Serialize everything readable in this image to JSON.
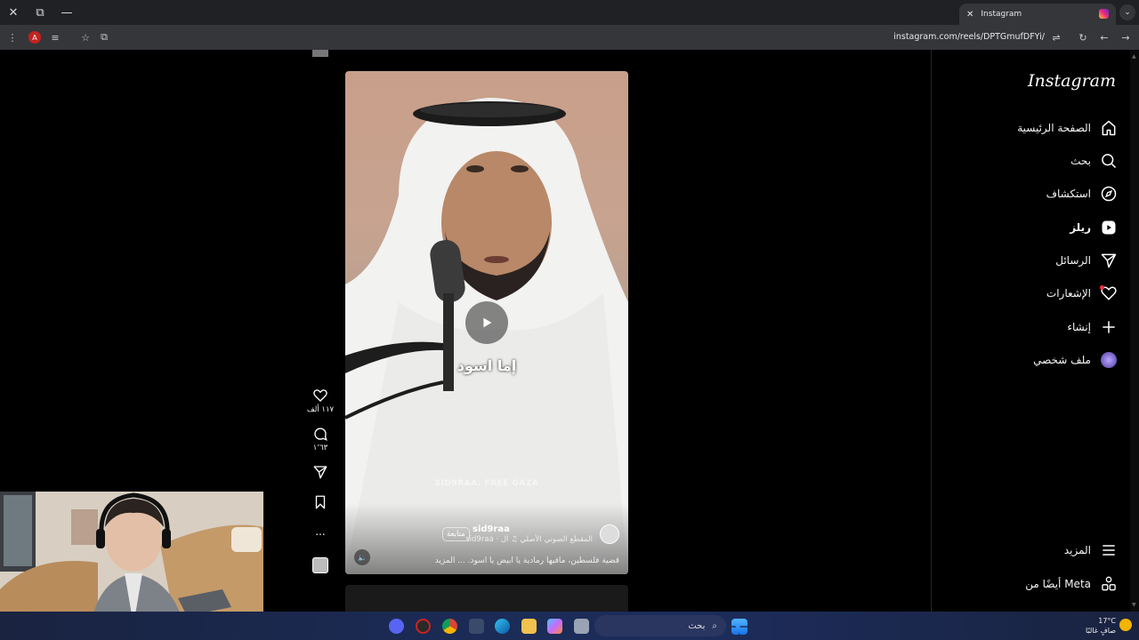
{
  "browser": {
    "tab_title": "Instagram",
    "url": "instagram.com/reels/DPTGmufDFYi/",
    "profile_initial": "A",
    "close_tab_glyph": "✕",
    "new_tab_glyph": "+",
    "tab_menu_glyph": "⌄",
    "win_close_glyph": "✕",
    "win_restore_glyph": "⧉",
    "win_min_glyph": "—"
  },
  "sidebar": {
    "logo": "Instagram",
    "items": [
      {
        "label": "الصفحة الرئيسية",
        "icon": "home-icon"
      },
      {
        "label": "بحث",
        "icon": "search-icon"
      },
      {
        "label": "استكشاف",
        "icon": "compass-icon"
      },
      {
        "label": "ريلز",
        "icon": "reels-icon"
      },
      {
        "label": "الرسائل",
        "icon": "send-icon"
      },
      {
        "label": "الإشعارات",
        "icon": "heart-icon"
      },
      {
        "label": "إنشاء",
        "icon": "plus-icon"
      },
      {
        "label": "ملف شخصي",
        "icon": "profile-avatar"
      }
    ],
    "more_label": "المزيد",
    "meta_label": "أيضًا من Meta"
  },
  "reel": {
    "subtitle": "إما اسود",
    "watermark": "SID9RAA: FREE GAZA",
    "username": "sid9raa",
    "follow_label": "متابعة",
    "audio_text": "sid9raa · المقطع الصوتي الأصلي ♫ ال",
    "caption": "قضية فلسطين، مافيها رمادية يا ابيض يا اسود. ... المزيد"
  },
  "actions": {
    "likes": "١١٧ ألف",
    "comments": "١٬٦٣",
    "more_glyph": "..."
  },
  "taskbar": {
    "search_placeholder": "بحث",
    "temperature": "17°C",
    "weather_text": "صافٍ غالبًا"
  },
  "colors": {
    "background": "#000000",
    "chrome_tab": "#202124",
    "chrome_toolbar": "#35363a",
    "notification_dot": "#ff3040"
  }
}
